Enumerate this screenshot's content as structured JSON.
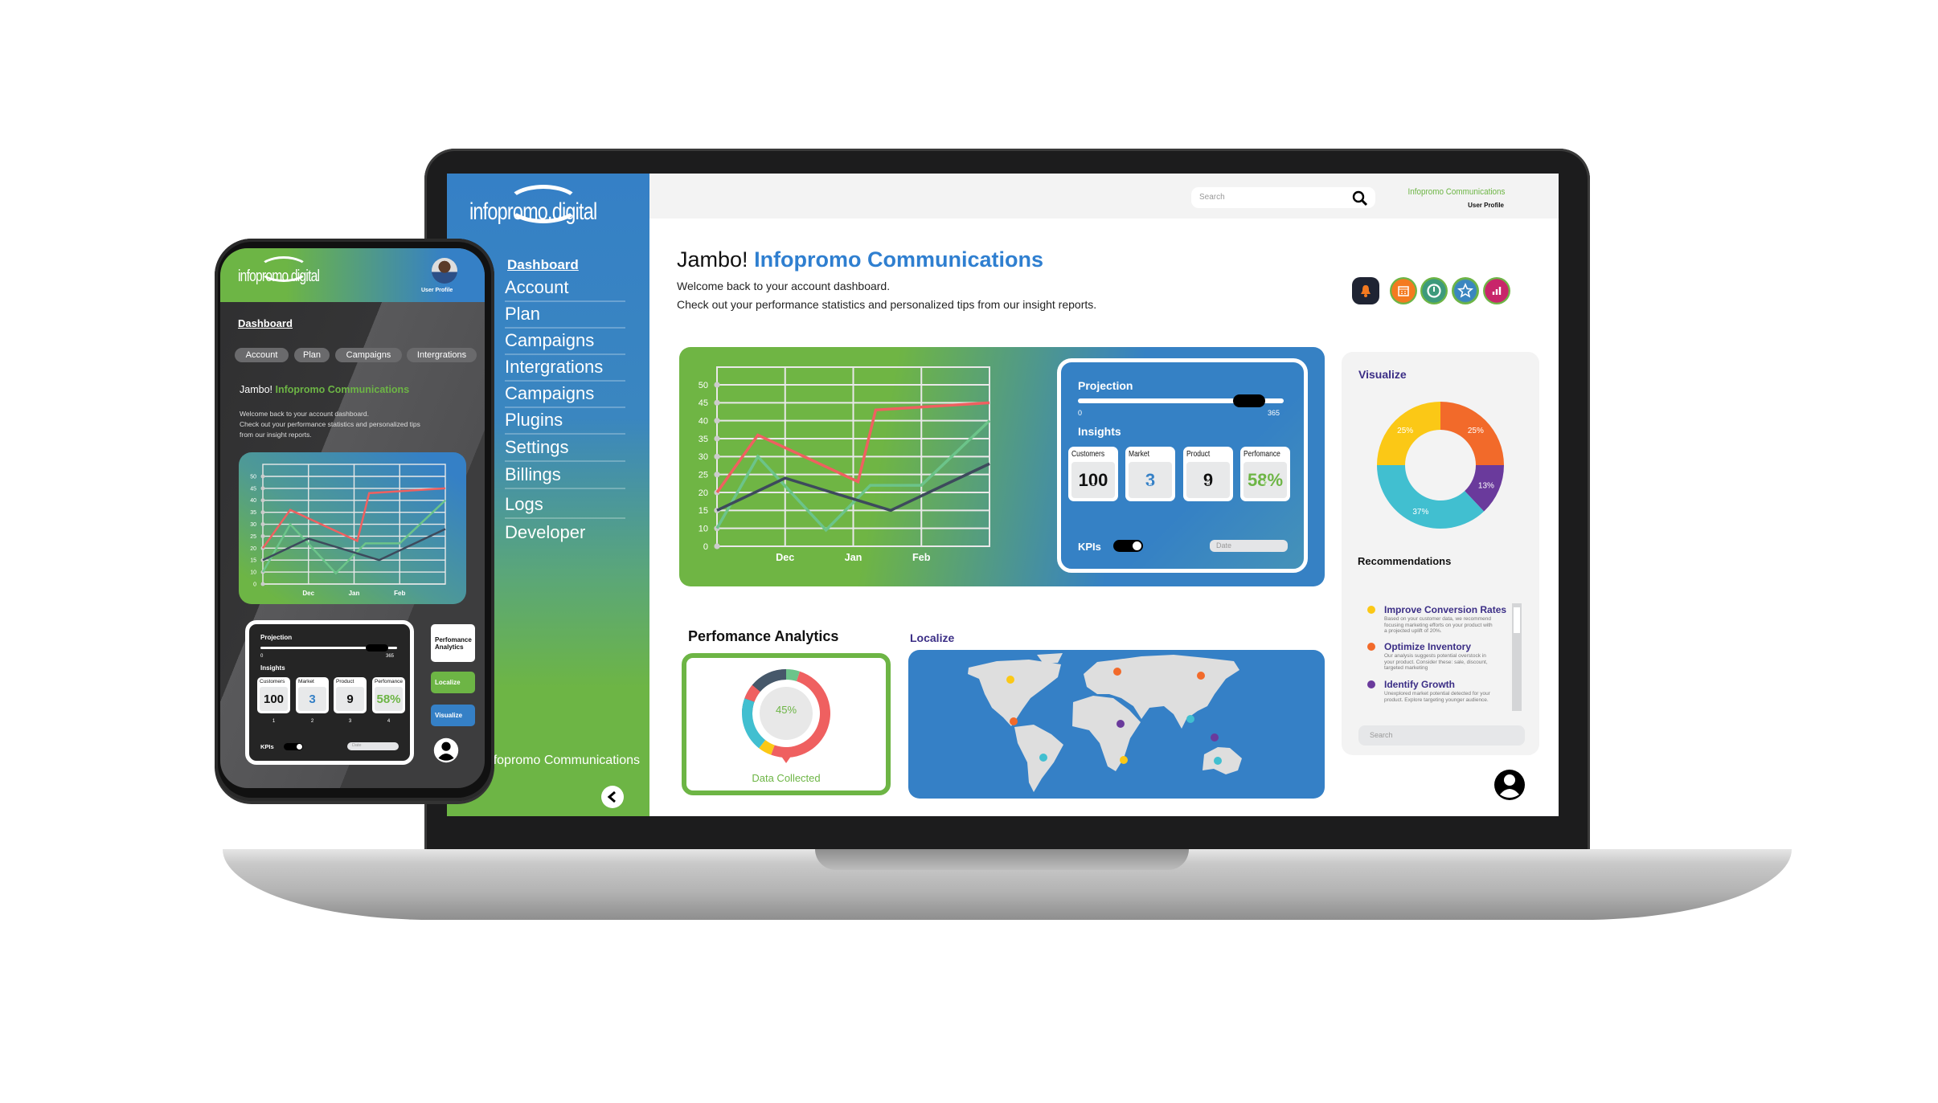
{
  "colors": {
    "green": "#6db545",
    "blue": "#3580c6",
    "dark": "#1c1c1d",
    "red": "#ef6060",
    "purple": "#6a3a9c",
    "orange": "#f26a2a",
    "yellow": "#fbc816",
    "cyan": "#41bfd0",
    "navy_text": "#3b2e86"
  },
  "laptop": {
    "sidebar": {
      "logo": "infopromo.digital",
      "active_item": "Dashboard",
      "items": [
        "Account",
        "Plan",
        "Campaigns",
        "Intergrations",
        "Campaigns",
        "Plugins",
        "Settings",
        "Billings",
        "Logs",
        "Developer"
      ],
      "footer_text": "Infopromo Communications",
      "collapse_icon": "chevron-left-icon"
    },
    "topbar": {
      "search_placeholder": "Search",
      "search_icon": "search-icon",
      "user_name": "Infopromo Communications",
      "user_role": "User Profile"
    },
    "greeting": {
      "prefix": "Jambo!",
      "name": "Infopromo Communications",
      "line1": "Welcome back to your account dashboard.",
      "line2": "Check out your performance statistics and personalized tips from our insight reports."
    },
    "quick_icons": [
      "bell-icon",
      "calendar-icon",
      "clock-icon",
      "star-icon",
      "bar-chart-icon"
    ],
    "projection": {
      "title": "Projection",
      "slider_min": "0",
      "slider_max": "365",
      "slider_value_fraction": 0.8,
      "insights_title": "Insights",
      "insights": [
        {
          "label": "Customers",
          "value": "100",
          "index": "1",
          "color": "#111111"
        },
        {
          "label": "Market",
          "value": "3",
          "index": "2",
          "color": "#3580c6"
        },
        {
          "label": "Product",
          "value": "9",
          "index": "3",
          "color": "#111111"
        },
        {
          "label": "Perfomance",
          "value": "58%",
          "index": "4",
          "color": "#6db545"
        }
      ],
      "kpis_label": "KPIs",
      "kpis_on": true,
      "date_placeholder": "Date"
    },
    "performance": {
      "title": "Perfomance Analytics",
      "value": "45%",
      "caption": "Data Collected"
    },
    "localize": {
      "title": "Localize",
      "markers": [
        "#fbc816",
        "#f26a2a",
        "#f26a2a",
        "#f26a2a",
        "#6a3a9c",
        "#41bfd0",
        "#6a3a9c",
        "#41bfd0",
        "#fbc816",
        "#41bfd0"
      ]
    },
    "visualize": {
      "title": "Visualize"
    },
    "recommendations": {
      "title": "Recommendations",
      "items": [
        {
          "title": "Improve Conversion Rates",
          "desc": "Based on your customer data, we recommend focusing marketing efforts on your product with a projected uplift of 20%.",
          "color": "#fbc816"
        },
        {
          "title": "Optimize Inventory",
          "desc": "Our analysis suggests potential overstock in your product. Consider these: sale, discount, targeted marketing",
          "color": "#f26a2a"
        },
        {
          "title": "Identify Growth",
          "desc": "Unexplored market potential detected for your product. Explore targeting younger audience.",
          "color": "#6a3a9c"
        }
      ],
      "search_placeholder": "Search"
    }
  },
  "phone": {
    "logo": "infopromo.digital",
    "user_role": "User Profile",
    "active_item": "Dashboard",
    "pills": [
      "Account",
      "Plan",
      "Campaigns",
      "Intergrations"
    ],
    "greeting": {
      "prefix": "Jambo!",
      "name": "Infopromo Communications",
      "line1": "Welcome back to your account dashboard.",
      "line2": "Check out your performance statistics and personalized tips",
      "line3": "from our insight reports."
    },
    "projection": {
      "title": "Projection",
      "slider_min": "0",
      "slider_max": "365",
      "insights_title": "Insights",
      "insights": [
        {
          "label": "Customers",
          "value": "100",
          "index": "1",
          "color": "#111111"
        },
        {
          "label": "Market",
          "value": "3",
          "index": "2",
          "color": "#3580c6"
        },
        {
          "label": "Product",
          "value": "9",
          "index": "3",
          "color": "#111111"
        },
        {
          "label": "Perfomance",
          "value": "58%",
          "index": "4",
          "color": "#6db545"
        }
      ],
      "kpis_label": "KPIs",
      "date_placeholder": "Date"
    },
    "buttons": [
      "Perfomance Analytics",
      "Localize",
      "Visualize"
    ]
  },
  "chart_data": [
    {
      "type": "line",
      "categories": [
        "Dec",
        "Jan",
        "Feb"
      ],
      "y_ticks": [
        0,
        10,
        15,
        20,
        25,
        30,
        35,
        40,
        45,
        50
      ],
      "ylim": [
        0,
        50
      ],
      "grid": true,
      "x_note_index": "Dec=1, Jan=2, Feb=3",
      "series": [
        {
          "color": "#ef6060",
          "points": [
            [
              0,
              20
            ],
            [
              0.6,
              36
            ],
            [
              2.07,
              23
            ],
            [
              2.33,
              43
            ],
            [
              4,
              45
            ]
          ]
        },
        {
          "color": "#6cc48a",
          "points": [
            [
              0,
              10
            ],
            [
              0.6,
              30
            ],
            [
              1.6,
              9
            ],
            [
              2.25,
              22
            ],
            [
              3,
              22
            ],
            [
              4,
              40
            ]
          ]
        },
        {
          "color": "#3d4a5c",
          "phone_color": "#2f7fd0",
          "points": [
            [
              0,
              15
            ],
            [
              1,
              24
            ],
            [
              2.55,
              15
            ],
            [
              4,
              28
            ]
          ]
        }
      ]
    },
    {
      "type": "pie",
      "donut": true,
      "values": [
        25,
        13,
        37,
        25
      ],
      "labels": [
        "25%",
        "13%",
        "37%",
        "25%"
      ],
      "colors": [
        "#f26a2a",
        "#6a3a9c",
        "#41bfd0",
        "#fbc816"
      ]
    }
  ]
}
